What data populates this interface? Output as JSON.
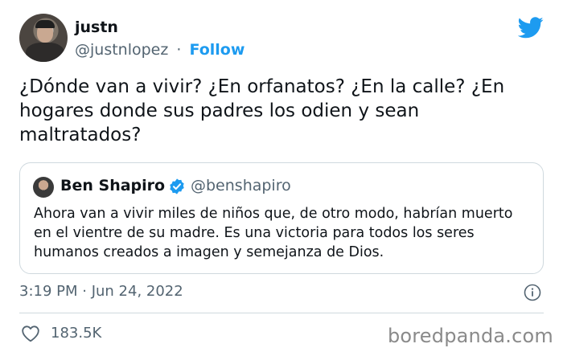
{
  "author": {
    "name": "justn",
    "handle": "@justnlopez",
    "separator": "·",
    "follow_label": "Follow"
  },
  "tweet": {
    "text": "¿Dónde van a vivir? ¿En orfanatos? ¿En la calle? ¿En hogares donde sus padres los odien y sean maltratados?"
  },
  "quoted": {
    "name": "Ben Shapiro",
    "handle": "@benshapiro",
    "verified": true,
    "text": "Ahora van a vivir miles de niños que, de otro modo, habrían muerto en el vientre de su madre. Es una victoria para todos los seres humanos creados a imagen y semejanza de Dios."
  },
  "meta": {
    "timestamp": "3:19 PM · Jun 24, 2022"
  },
  "engagement": {
    "likes": "183.5K"
  },
  "watermark": "boredpanda.com",
  "colors": {
    "accent": "#1d9bf0",
    "text": "#0f1419",
    "muted": "#536471",
    "border": "#cfd9de"
  },
  "icons": [
    "twitter-bird-icon",
    "verified-badge-icon",
    "info-icon",
    "heart-icon"
  ]
}
